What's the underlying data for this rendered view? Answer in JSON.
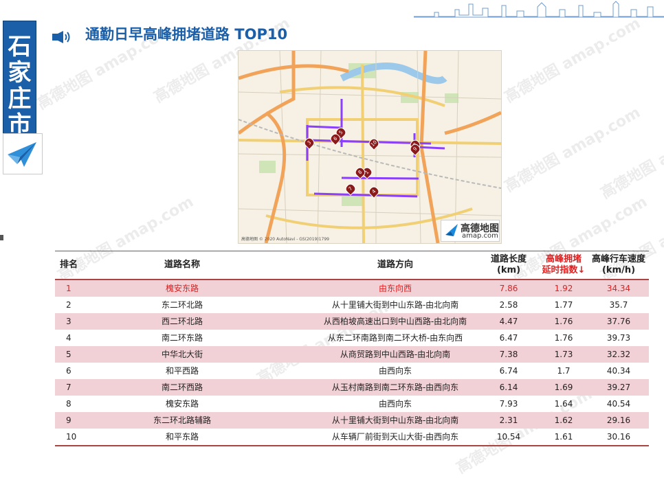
{
  "header": {
    "city": "石家庄市",
    "title": "通勤日早高峰拥堵道路 TOP10"
  },
  "map": {
    "logo_main": "高德地图",
    "logo_sub": "amap.com",
    "copyright": "高德地图 © 2020 AutoNavi - GS(2019)1799",
    "markers": [
      "1",
      "2",
      "3",
      "4",
      "5",
      "6",
      "7",
      "8",
      "9",
      "10"
    ]
  },
  "table": {
    "headers": {
      "rank": "排名",
      "name": "道路名称",
      "direction": "道路方向",
      "length": "道路长度\n(km)",
      "index": "高峰拥堵\n延时指数↓",
      "speed": "高峰行车速度\n(km/h)"
    },
    "rows": [
      {
        "rank": "1",
        "name": "槐安东路",
        "direction": "由东向西",
        "length": "7.86",
        "index": "1.92",
        "speed": "34.34"
      },
      {
        "rank": "2",
        "name": "东二环北路",
        "direction": "从十里铺大街到中山东路-由北向南",
        "length": "2.58",
        "index": "1.77",
        "speed": "35.7"
      },
      {
        "rank": "3",
        "name": "西二环北路",
        "direction": "从西柏坡高速出口到中山西路-由北向南",
        "length": "4.47",
        "index": "1.76",
        "speed": "37.76"
      },
      {
        "rank": "4",
        "name": "南二环东路",
        "direction": "从东二环南路到南二环大桥-由东向西",
        "length": "6.47",
        "index": "1.76",
        "speed": "39.73"
      },
      {
        "rank": "5",
        "name": "中华北大街",
        "direction": "从商贸路到中山西路-由北向南",
        "length": "7.38",
        "index": "1.73",
        "speed": "32.32"
      },
      {
        "rank": "6",
        "name": "和平西路",
        "direction": "由西向东",
        "length": "6.74",
        "index": "1.7",
        "speed": "40.34"
      },
      {
        "rank": "7",
        "name": "南二环西路",
        "direction": "从玉村南路到南二环东路-由西向东",
        "length": "6.14",
        "index": "1.69",
        "speed": "39.27"
      },
      {
        "rank": "8",
        "name": "槐安东路",
        "direction": "由西向东",
        "length": "7.93",
        "index": "1.64",
        "speed": "40.54"
      },
      {
        "rank": "9",
        "name": "东二环北路辅路",
        "direction": "从十里铺大街到中山东路-由北向南",
        "length": "2.31",
        "index": "1.62",
        "speed": "29.16"
      },
      {
        "rank": "10",
        "name": "和平东路",
        "direction": "从车辆厂前街到天山大街-由西向东",
        "length": "10.54",
        "index": "1.61",
        "speed": "30.16"
      }
    ]
  },
  "watermark": "高德地图 amap.com",
  "colors": {
    "brand_blue": "#1a5fa8",
    "highlight_red": "#e02020",
    "row_pink": "#f2d1d6",
    "rule_red": "#a94442",
    "congestion_purple": "#8a3ffc"
  }
}
